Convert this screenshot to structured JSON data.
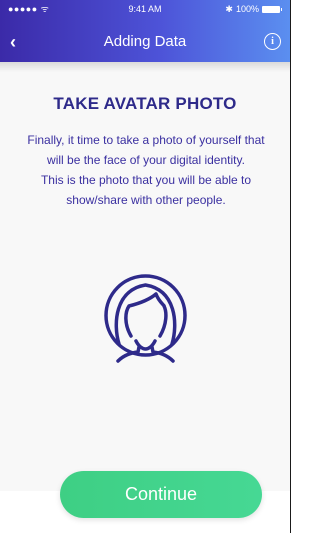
{
  "status_bar": {
    "signal": "●●●●● ᯤ",
    "time": "9:41 AM",
    "bluetooth": "✱",
    "battery": "100%"
  },
  "nav": {
    "back": "‹",
    "title": "Adding Data",
    "info": "i"
  },
  "content": {
    "heading": "TAKE AVATAR PHOTO",
    "line1": "Finally, it time to take a photo of yourself that will be the face of your digital identity.",
    "line2": "This is the photo that you will be able to show/share with other people."
  },
  "footer": {
    "continue_label": "Continue"
  },
  "colors": {
    "header_start": "#3b2aa8",
    "header_end": "#5b8ff0",
    "accent_text": "#2e2a8a",
    "button": "#3ecf84"
  },
  "icons": [
    "back-chevron-icon",
    "info-icon",
    "wifi-icon",
    "bluetooth-icon",
    "battery-icon",
    "avatar-placeholder-icon"
  ]
}
